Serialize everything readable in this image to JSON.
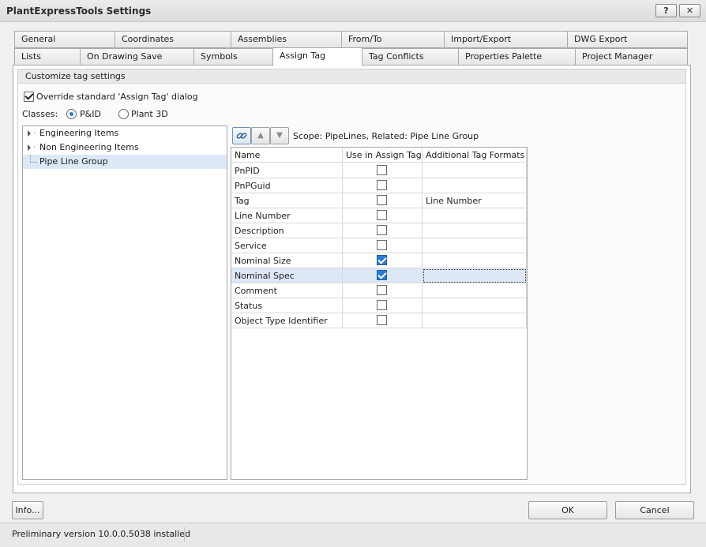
{
  "window": {
    "title": "PlantExpressTools Settings",
    "help_btn": "?",
    "close_btn": "✕"
  },
  "tabs_row1": [
    "General",
    "Coordinates",
    "Assemblies",
    "From/To",
    "Import/Export",
    "DWG Export"
  ],
  "tabs_row2": [
    "Lists",
    "On Drawing Save",
    "Symbols",
    "Assign Tag",
    "Tag Conflicts",
    "Properties Palette",
    "Project Manager"
  ],
  "active_tab": "Assign Tag",
  "group": {
    "caption": "Customize tag settings"
  },
  "override": {
    "label": "Override standard 'Assign Tag' dialog",
    "checked": true
  },
  "classes": {
    "label": "Classes:",
    "options": [
      "P&ID",
      "Plant 3D"
    ],
    "selected": "P&ID"
  },
  "tree": {
    "items": [
      "Engineering Items",
      "Non Engineering Items",
      "Pipe Line Group"
    ],
    "selected": "Pipe Line Group"
  },
  "toolbar": {
    "link_icon": "link-icon",
    "up_icon": "arrow-up-icon",
    "down_icon": "arrow-down-icon"
  },
  "scope": "Scope: PipeLines, Related: Pipe Line Group",
  "grid": {
    "columns": [
      "Name",
      "Use in Assign Tag",
      "Additional Tag Formats"
    ],
    "rows": [
      {
        "name": "PnPID",
        "use": false,
        "format": ""
      },
      {
        "name": "PnPGuid",
        "use": false,
        "format": ""
      },
      {
        "name": "Tag",
        "use": false,
        "format": "Line Number"
      },
      {
        "name": "Line Number",
        "use": false,
        "format": ""
      },
      {
        "name": "Description",
        "use": false,
        "format": ""
      },
      {
        "name": "Service",
        "use": false,
        "format": ""
      },
      {
        "name": "Nominal Size",
        "use": true,
        "format": ""
      },
      {
        "name": "Nominal Spec",
        "use": true,
        "format": ""
      },
      {
        "name": "Comment",
        "use": false,
        "format": ""
      },
      {
        "name": "Status",
        "use": false,
        "format": ""
      },
      {
        "name": "Object Type Identifier",
        "use": false,
        "format": ""
      }
    ]
  },
  "buttons": {
    "info": "Info...",
    "ok": "OK",
    "cancel": "Cancel"
  },
  "status": {
    "text": "Preliminary version 10.0.0.5038 installed"
  },
  "colors": {
    "accent": "#2d7bd1",
    "selection": "#dde8f7"
  }
}
